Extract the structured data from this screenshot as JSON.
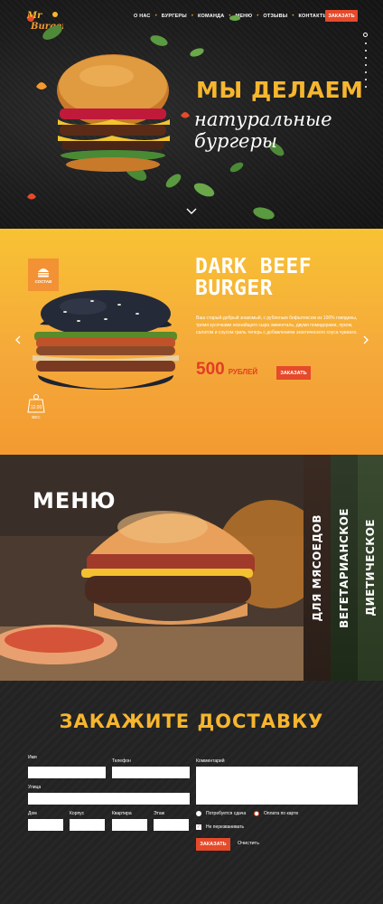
{
  "nav": {
    "items": [
      "О НАС",
      "БУРГЕРЫ",
      "КОМАНДА",
      "МЕНЮ",
      "ОТЗЫВЫ",
      "КОНТАКТЫ"
    ],
    "order_label": "ЗАКАЗАТЬ",
    "logo_text": "Mr Burger"
  },
  "hero": {
    "title_line1": "МЫ ДЕЛАЕМ",
    "title_line2": "натуральные бургеры",
    "slider_dots": 8,
    "active_dot": 0
  },
  "featured": {
    "sostav_label": "СОСТАВ",
    "title": "DARK BEEF BURGER",
    "description": "Ваш старый-добрый знакомый, с рубленым бифштексом из 100% говядины, тремя кусочками незнайщего сыра эмменталь, двумя помидорами, луком, салатом и соусом гриль теперь с добавлением экзотического соуса чувиахо.",
    "price": "500",
    "currency": "РУБЛЕЙ",
    "order_label": "ЗАКАЗАТЬ",
    "weight_value": "12.00",
    "weight_label": "ВЕС"
  },
  "menu": {
    "title": "МЕНЮ",
    "categories": [
      "ДЛЯ МЯСОЕДОВ",
      "ВЕГЕТАРИАНСКОЕ",
      "ДИЕТИЧЕСКОЕ"
    ]
  },
  "order_form": {
    "title": "ЗАКАЖИТЕ ДОСТАВКУ",
    "name_label": "Имя",
    "phone_label": "Телефон",
    "street_label": "Улица",
    "house_label": "Дом",
    "korpus_label": "Корпус",
    "apartment_label": "Квартира",
    "floor_label": "Этаж",
    "comment_label": "Комментарий",
    "change_label": "Потребуется сдача",
    "card_label": "Оплата по карте",
    "no_callback_label": "Не перезванивать",
    "submit_label": "ЗАКАЗАТЬ",
    "clear_label": "Очистить"
  },
  "colors": {
    "accent_red": "#e54a2a",
    "accent_yellow": "#f7b62f",
    "orange_bg": "#f5a93a"
  }
}
